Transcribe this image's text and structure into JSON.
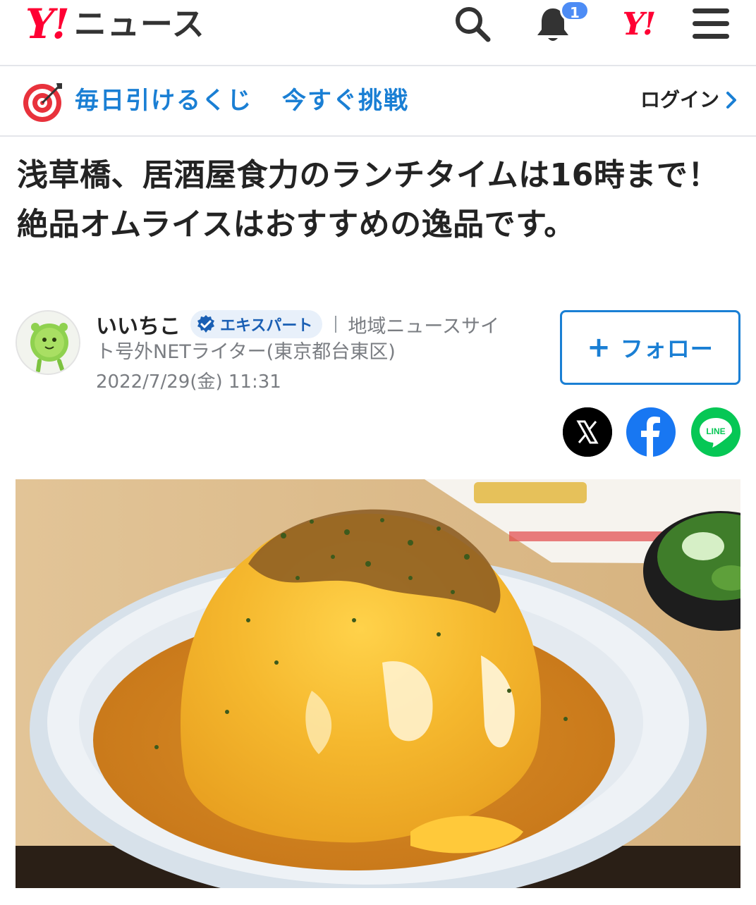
{
  "header": {
    "logo_mark": "Y!",
    "logo_text": "ニュース",
    "notification_count": "1",
    "yahoo_mark": "Y!",
    "icons": [
      "search-icon",
      "bell-icon",
      "yahoo-japan-icon",
      "menu-icon"
    ]
  },
  "lottery": {
    "text_1": "毎日引けるくじ",
    "text_2": "今すぐ挑戦",
    "login_label": "ログイン"
  },
  "article": {
    "title": "浅草橋、居酒屋食力のランチタイムは16時まで！ 絶品オムライスはおすすめの逸品です。"
  },
  "author": {
    "name": "いいちこ",
    "badge": "エキスパート",
    "affiliation_1": "地域ニュースサイ",
    "affiliation_2": "ト号外NETライター(東京都台東区)",
    "date": "2022/7/29(金) 11:31"
  },
  "follow": {
    "label": "フォロー"
  },
  "share": {
    "line_label": "LINE"
  },
  "colors": {
    "brand_red": "#ff0033",
    "link_blue": "#1a7fd4",
    "badge_blue": "#4d8cf5",
    "facebook_blue": "#1877f2",
    "line_green": "#06c755"
  }
}
